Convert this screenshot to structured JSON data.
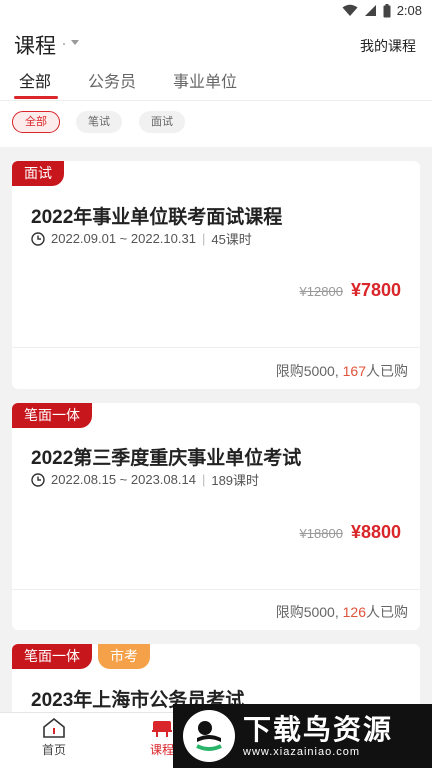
{
  "status_bar": {
    "time": "2:08"
  },
  "header": {
    "title": "课程",
    "right_link": "我的课程"
  },
  "tabs": [
    {
      "label": "全部"
    },
    {
      "label": "公务员"
    },
    {
      "label": "事业单位"
    }
  ],
  "filters": [
    {
      "label": "全部"
    },
    {
      "label": "笔试"
    },
    {
      "label": "面试"
    }
  ],
  "courses": [
    {
      "tag": "面试",
      "title": "2022年事业单位联考面试课程",
      "dates": "2022.09.01 ~ 2022.10.31",
      "hours": "45课时",
      "old_price": "¥12800",
      "price": "¥7800",
      "limit": "限购5000,",
      "bought": "167",
      "bought_suffix": "人已购"
    },
    {
      "tag": "笔面一体",
      "title": "2022第三季度重庆事业单位考试",
      "dates": "2022.08.15 ~ 2023.08.14",
      "hours": "189课时",
      "old_price": "¥18800",
      "price": "¥8800",
      "limit": "限购5000,",
      "bought": "126",
      "bought_suffix": "人已购"
    },
    {
      "tag": "笔面一体",
      "tag2": "市考",
      "title": "2023年上海市公务员考试"
    }
  ],
  "bottom_nav": [
    {
      "label": "首页",
      "icon": "home-icon"
    },
    {
      "label": "课程",
      "icon": "course-icon"
    }
  ],
  "watermark": {
    "title": "下载鸟资源",
    "url": "www.xiazainiao.com"
  },
  "colors": {
    "accent": "#d9262a",
    "tag": "#c8161d",
    "orange": "#f5a14a"
  }
}
